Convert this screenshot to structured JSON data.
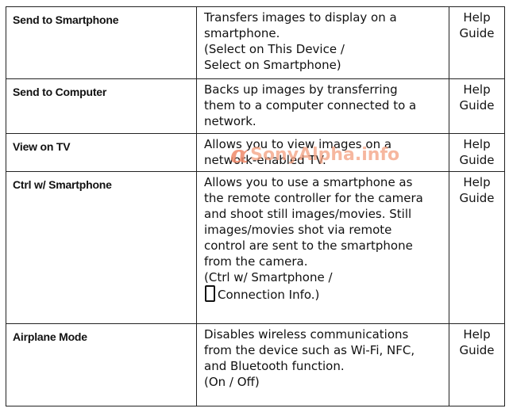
{
  "rows": [
    {
      "name": "Send to Smartphone",
      "desc": [
        "Transfers images to display on a",
        "smartphone.",
        "(Select on This Device /",
        "Select on Smartphone)"
      ],
      "help": [
        "Help",
        "Guide"
      ]
    },
    {
      "name": "Send to Computer",
      "desc": [
        "Backs up images by transferring",
        "them to a computer connected to a",
        "network."
      ],
      "help": [
        "Help",
        "Guide"
      ]
    },
    {
      "name": "View on TV",
      "desc": [
        "Allows you to view images on a",
        "network-enabled TV."
      ],
      "help": [
        "Help",
        "Guide"
      ]
    },
    {
      "name": "Ctrl w/ Smartphone",
      "desc": [
        "Allows you to use a smartphone as",
        "the remote controller for the camera",
        "and shoot still images/movies. Still",
        "images/movies shot via remote",
        "control are sent to the smartphone",
        "from the camera.",
        "(Ctrl w/ Smartphone /"
      ],
      "desc_icon_line": "Connection Info.)",
      "icon": "smartphone-icon",
      "help": [
        "Help",
        "Guide"
      ]
    },
    {
      "name": "Airplane Mode",
      "desc": [
        "Disables wireless communications",
        "from the device such as Wi-Fi, NFC,",
        "and Bluetooth function.",
        "(On / Off)"
      ],
      "help": [
        "Help",
        "Guide"
      ]
    }
  ],
  "watermark": {
    "symbol": "α",
    "text": "SonyAlpha.info"
  },
  "colors": {
    "border": "#222222",
    "text": "#111111",
    "watermark": "#f4a080"
  }
}
